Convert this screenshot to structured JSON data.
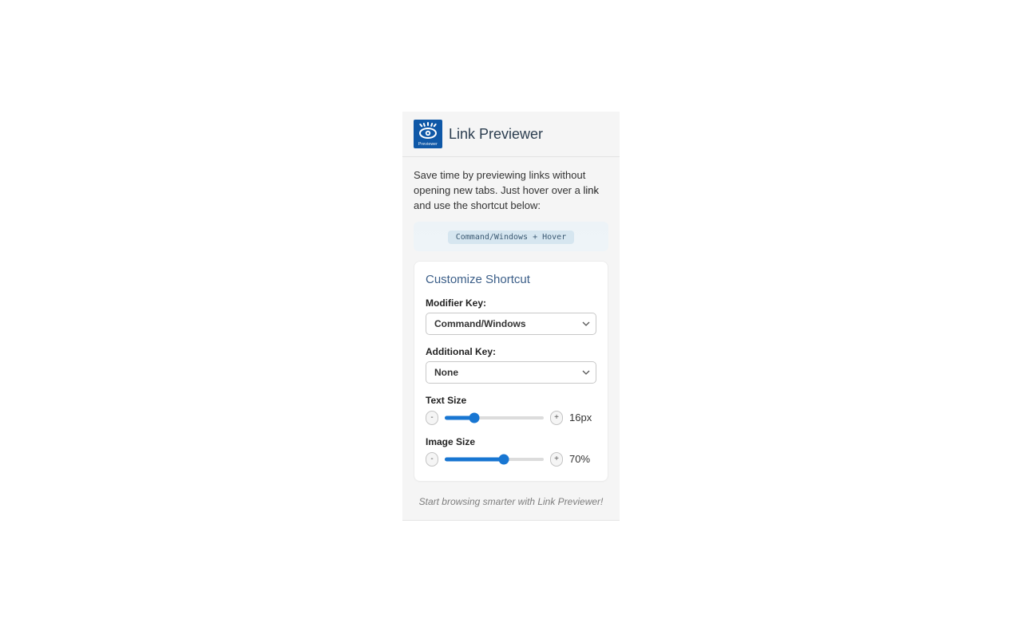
{
  "header": {
    "logo_label": "Previewer",
    "title": "Link Previewer"
  },
  "description": {
    "text_part1": "Save time by previewing links without opening new tabs. Just hover over a ",
    "link_word": "link",
    "text_part2": " and use the shortcut below:"
  },
  "shortcut": {
    "display": "Command/Windows + Hover"
  },
  "card": {
    "title": "Customize Shortcut",
    "modifier": {
      "label": "Modifier Key:",
      "value": "Command/Windows"
    },
    "additional": {
      "label": "Additional Key:",
      "value": "None"
    },
    "text_size": {
      "label": "Text Size",
      "value_display": "16px",
      "fill_percent": 30,
      "minus": "-",
      "plus": "+"
    },
    "image_size": {
      "label": "Image Size",
      "value_display": "70%",
      "fill_percent": 60,
      "minus": "-",
      "plus": "+"
    }
  },
  "footer": {
    "text": "Start browsing smarter with Link Previewer!"
  }
}
